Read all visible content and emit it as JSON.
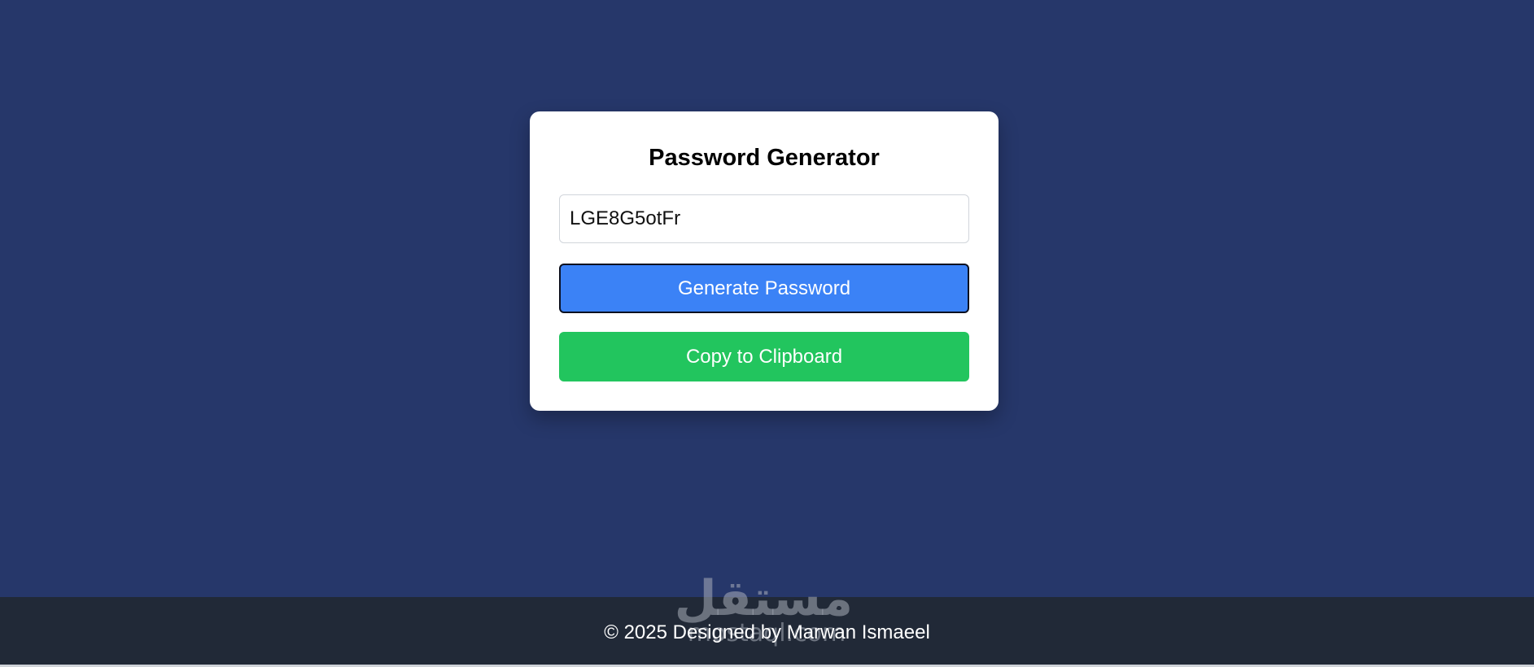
{
  "card": {
    "title": "Password Generator",
    "password_value": "LGE8G5otFr",
    "generate_label": "Generate Password",
    "copy_label": "Copy to Clipboard"
  },
  "footer": {
    "text": "© 2025 Designed by Marwan Ismaeel"
  },
  "watermark": {
    "arabic": "مستقل",
    "latin": "mostaql.com"
  },
  "colors": {
    "background": "#26376a",
    "card": "#ffffff",
    "generate_button": "#3b82f6",
    "copy_button": "#22c55e",
    "footer": "#212937"
  }
}
